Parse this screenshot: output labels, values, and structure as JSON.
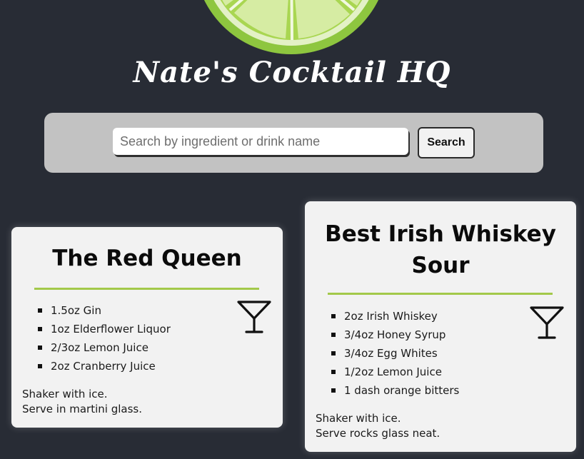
{
  "colors": {
    "background": "#282c35",
    "search_panel": "#c2c2c2",
    "card_background": "#f2f2f2",
    "accent_divider": "#a3c94a",
    "lime_outer": "#8ec63f",
    "lime_inner": "#c7e68a"
  },
  "header": {
    "logo_icon": "lime-slice-icon",
    "title": "Nate's Cocktail HQ"
  },
  "search": {
    "placeholder": "Search by ingredient or drink name",
    "value": "",
    "button_label": "Search"
  },
  "cocktails": [
    {
      "name": "The Red Queen",
      "icon": "martini-glass-icon",
      "ingredients": [
        "1.5oz Gin",
        "1oz Elderflower Liquor",
        "2/3oz Lemon Juice",
        "2oz Cranberry Juice"
      ],
      "instructions": [
        "Shaker with ice.",
        "Serve in martini glass."
      ]
    },
    {
      "name": "Best Irish Whiskey Sour",
      "icon": "martini-glass-icon",
      "ingredients": [
        "2oz Irish Whiskey",
        "3/4oz Honey Syrup",
        "3/4oz Egg Whites",
        "1/2oz Lemon Juice",
        "1 dash orange bitters"
      ],
      "instructions": [
        "Shaker with ice.",
        "Serve rocks glass neat."
      ]
    }
  ]
}
